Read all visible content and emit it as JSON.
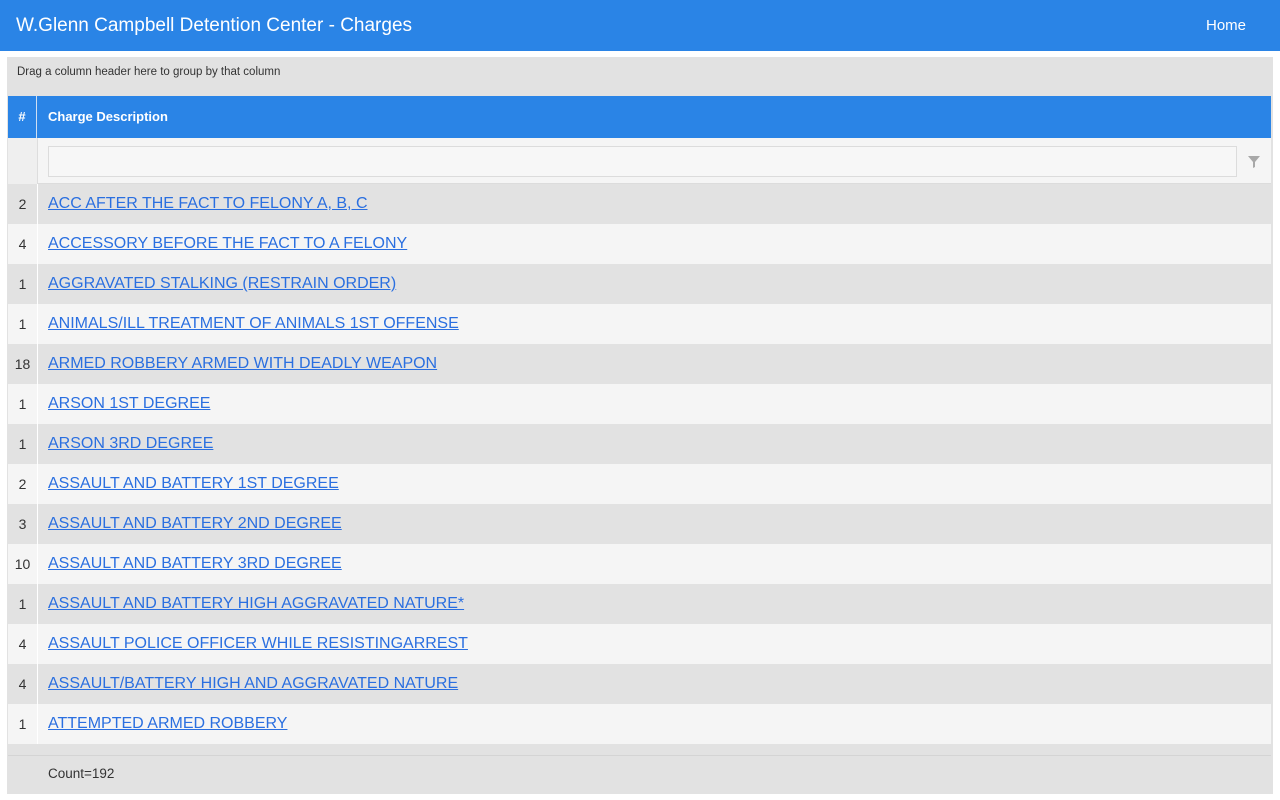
{
  "app": {
    "title": "W.Glenn Campbell Detention Center - Charges",
    "nav_home": "Home"
  },
  "grid": {
    "group_panel_text": "Drag a column header here to group by that column",
    "columns": {
      "count": "#",
      "description": "Charge Description"
    },
    "filter": {
      "value": "",
      "placeholder": ""
    },
    "rows": [
      {
        "count": "2",
        "charge": "ACC AFTER THE FACT TO FELONY A, B, C"
      },
      {
        "count": "4",
        "charge": "ACCESSORY BEFORE THE FACT TO A FELONY"
      },
      {
        "count": "1",
        "charge": "AGGRAVATED STALKING (RESTRAIN ORDER)"
      },
      {
        "count": "1",
        "charge": "ANIMALS/ILL TREATMENT OF ANIMALS 1ST OFFENSE"
      },
      {
        "count": "18",
        "charge": "ARMED ROBBERY ARMED WITH DEADLY WEAPON"
      },
      {
        "count": "1",
        "charge": "ARSON 1ST DEGREE"
      },
      {
        "count": "1",
        "charge": "ARSON 3RD DEGREE"
      },
      {
        "count": "2",
        "charge": "ASSAULT AND BATTERY 1ST DEGREE"
      },
      {
        "count": "3",
        "charge": "ASSAULT AND BATTERY 2ND DEGREE"
      },
      {
        "count": "10",
        "charge": "ASSAULT AND BATTERY 3RD DEGREE"
      },
      {
        "count": "1",
        "charge": "ASSAULT AND BATTERY HIGH AGGRAVATED NATURE*"
      },
      {
        "count": "4",
        "charge": "ASSAULT POLICE OFFICER WHILE RESISTINGARREST"
      },
      {
        "count": "4",
        "charge": "ASSAULT/BATTERY HIGH AND AGGRAVATED NATURE"
      },
      {
        "count": "1",
        "charge": "ATTEMPTED ARMED ROBBERY"
      }
    ],
    "footer_count": "Count=192"
  },
  "icons": {
    "filter": "funnel-icon"
  },
  "colors": {
    "header": "#2a84e6",
    "link": "#2a6fe0"
  }
}
